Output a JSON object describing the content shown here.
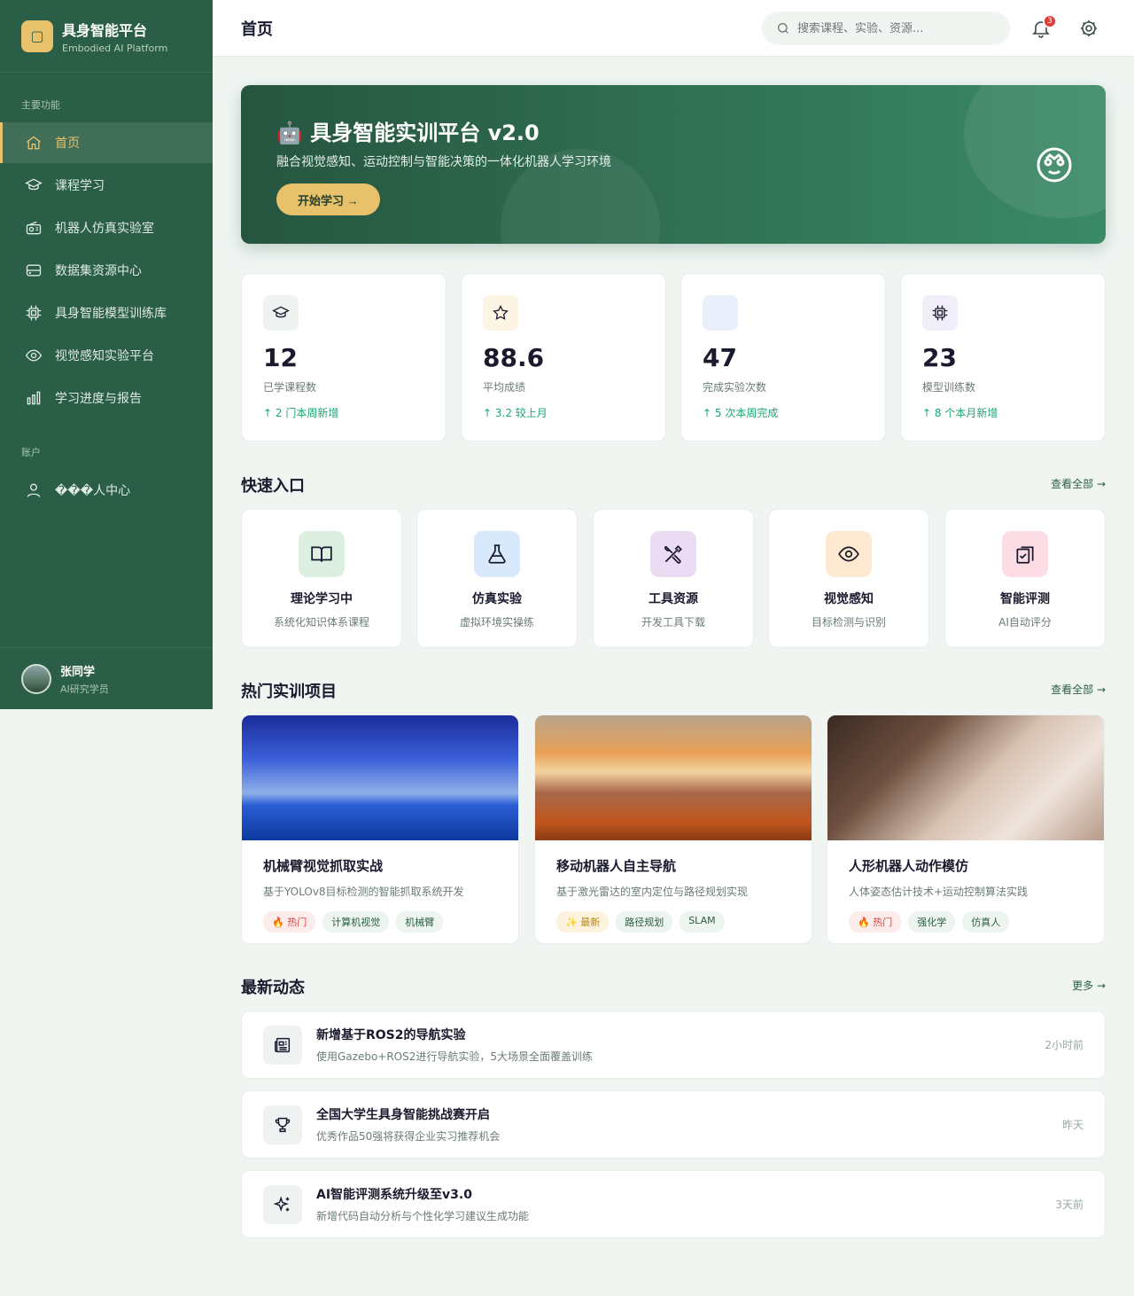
{
  "sidebar": {
    "brand_logo": "▢",
    "brand_title": "具身智能平台",
    "brand_sub": "Embodied AI Platform",
    "section_main": "主要功能",
    "section_account": "账户",
    "items": [
      {
        "label": "首页",
        "icon": "home-icon"
      },
      {
        "label": "课程学习",
        "icon": "graduation-cap-icon"
      },
      {
        "label": "机器人仿真实验室",
        "icon": "radio-icon"
      },
      {
        "label": "数据集资源中心",
        "icon": "hard-drive-icon"
      },
      {
        "label": "具身智能模型训练库",
        "icon": "cpu-icon"
      },
      {
        "label": "视觉感知实验平台",
        "icon": "eye-icon"
      },
      {
        "label": "学习进度与报告",
        "icon": "bar-chart-icon"
      }
    ],
    "account_items": [
      {
        "label": "���人中心",
        "icon": "user-icon"
      }
    ],
    "user": {
      "name": "张同学",
      "role": "AI研究学员"
    }
  },
  "header": {
    "title": "首页",
    "search_placeholder": "搜索课程、实验、资源...",
    "notification_count": "3"
  },
  "hero": {
    "title": "🤖 具身智能实训平台 v2.0",
    "desc": "融合视觉感知、运动控制与智能决策的一体化机器人学习环境",
    "button": "开始学习 →"
  },
  "stats": [
    {
      "value": "12",
      "label": "已学课程数",
      "trend": "↑ 2 门本周新增",
      "icon": "graduation-cap-icon",
      "bg": "#eef2f0"
    },
    {
      "value": "88.6",
      "label": "平均成绩",
      "trend": "↑ 3.2 较上月",
      "icon": "star-icon",
      "bg": "#fdf5e4"
    },
    {
      "value": "47",
      "label": "完成实验次数",
      "trend": "↑ 5 次本周完成",
      "icon": "",
      "bg": "#eaf0fb"
    },
    {
      "value": "23",
      "label": "模型训练数",
      "trend": "↑ 8 个本月新增",
      "icon": "cpu-icon",
      "bg": "#f1eefa"
    }
  ],
  "quick": {
    "title": "快速入口",
    "link": "查看全部 →",
    "items": [
      {
        "title": "理论学习中",
        "sub": "系统化知识体系课程",
        "icon": "book-open-icon",
        "bg": "#dcefe1"
      },
      {
        "title": "仿真实验",
        "sub": "虚拟环境实操练",
        "icon": "flask-icon",
        "bg": "#d8e9fb"
      },
      {
        "title": "工具资源",
        "sub": "开发工具下载",
        "icon": "tools-icon",
        "bg": "#ecdcf3"
      },
      {
        "title": "视觉感知",
        "sub": "目标检测与识别",
        "icon": "eye-icon",
        "bg": "#fde9cf"
      },
      {
        "title": "智能评测",
        "sub": "AI自动评分",
        "icon": "clipboard-check-icon",
        "bg": "#fcdde6"
      }
    ]
  },
  "projects": {
    "title": "热门实训项目",
    "link": "查看全部 →",
    "items": [
      {
        "title": "机械臂视觉抓取实战",
        "desc": "基于YOLOv8目标检测的智能抓取系统开发",
        "tags": [
          "🔥 热门",
          "计算机视觉",
          "机械臂"
        ],
        "tag_types": [
          "hot",
          "",
          ""
        ]
      },
      {
        "title": "移动机器人自主导航",
        "desc": "基于激光雷达的室内定位与路径规划实现",
        "tags": [
          "✨ 最新",
          "路径规划",
          "SLAM"
        ],
        "tag_types": [
          "new",
          "",
          ""
        ]
      },
      {
        "title": "人形机器人动作模仿",
        "desc": "人体姿态估计技术+运动控制算法实践",
        "tags": [
          "🔥 热门",
          "强化学",
          "仿真人"
        ],
        "tag_types": [
          "hot",
          "",
          ""
        ]
      }
    ]
  },
  "news": {
    "title": "最新动态",
    "link": "更多 →",
    "items": [
      {
        "title": "新增基于ROS2的导航实验",
        "desc": "使用Gazebo+ROS2进行导航实验，5大场景全面覆盖训练",
        "time": "2小时前",
        "icon": "newspaper-icon"
      },
      {
        "title": "全国大学生具身智能挑战赛开启",
        "desc": "优秀作品50强将获得企业实习推荐机会",
        "time": "昨天",
        "icon": "trophy-icon"
      },
      {
        "title": "AI智能评测系统升级至v3.0",
        "desc": "新增代码自动分析与个性化学习建议生成功能",
        "time": "3天前",
        "icon": "sparkles-icon"
      }
    ]
  }
}
